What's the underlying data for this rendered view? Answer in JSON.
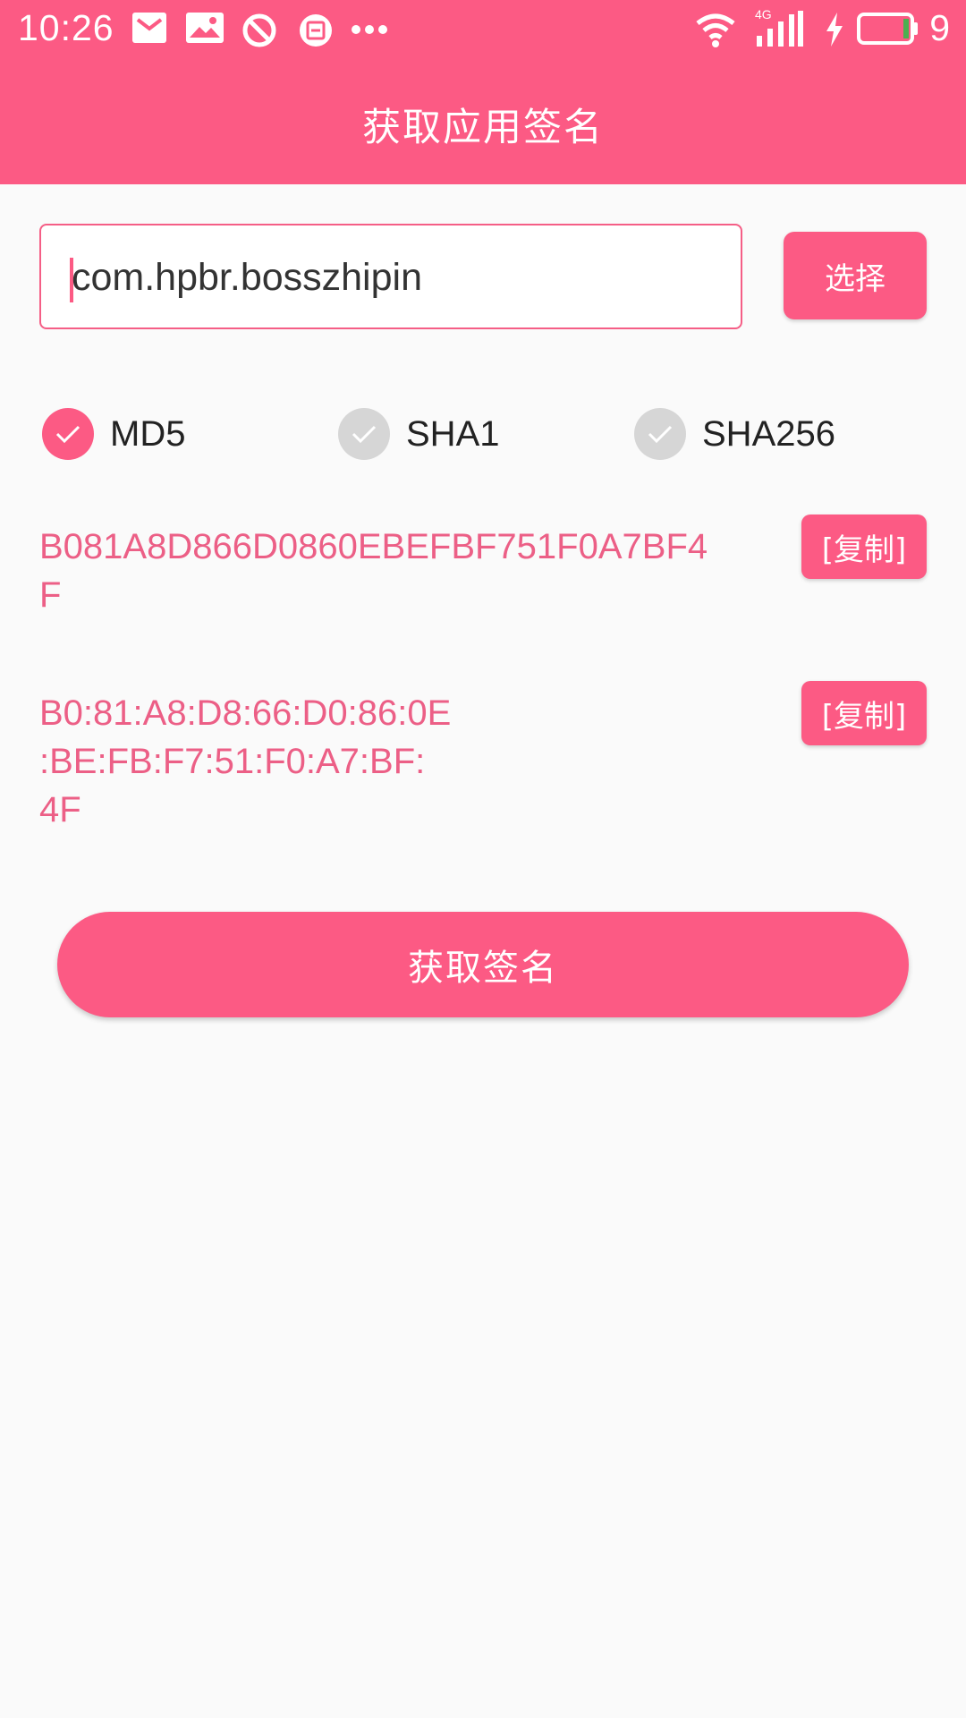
{
  "status_bar": {
    "time": "10:26",
    "battery_percent": "9",
    "network_label": "4G",
    "icons": [
      "mail-icon",
      "image-icon",
      "block-icon",
      "app-icon",
      "more-icon",
      "wifi-icon",
      "signal-icon",
      "charging-icon",
      "battery-icon"
    ]
  },
  "header": {
    "title": "获取应用签名"
  },
  "package_input": {
    "value": "com.hpbr.bosszhipin"
  },
  "select_button": {
    "label": "选择"
  },
  "algorithms": [
    {
      "label": "MD5",
      "checked": true
    },
    {
      "label": "SHA1",
      "checked": false
    },
    {
      "label": "SHA256",
      "checked": false
    }
  ],
  "results": [
    {
      "text": "B081A8D866D0860EBEFBF751F0A7BF4\nF",
      "copy_label": "[复制]"
    },
    {
      "text": "B0:81:A8:D8:66:D0:86:0E\n:BE:FB:F7:51:F0:A7:BF:\n4F",
      "copy_label": "[复制]"
    }
  ],
  "get_signature_button": {
    "label": "获取签名"
  },
  "colors": {
    "accent": "#fc5a84",
    "hash_text": "#ec5f86",
    "radio_off": "#d6d6d6"
  }
}
